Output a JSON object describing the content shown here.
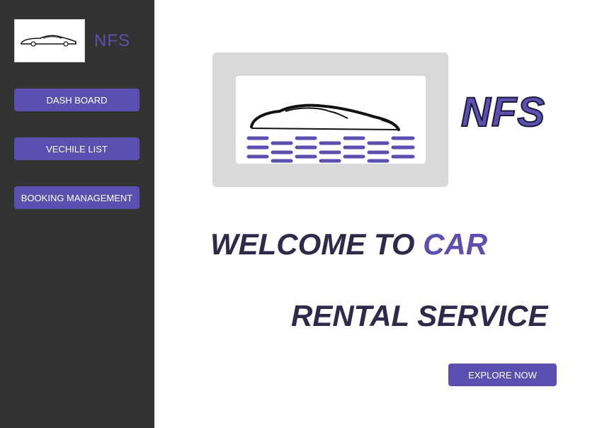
{
  "sidebar": {
    "brand": "NFS",
    "logo_icon": "car-silhouette-icon",
    "nav": [
      {
        "label": "DASH BOARD"
      },
      {
        "label": "VECHILE LIST"
      },
      {
        "label": "BOOKING MANAGEMENT"
      }
    ]
  },
  "hero": {
    "brand": "NFS",
    "image_icon": "car-logo-icon",
    "welcome_prefix": "WELCOME TO ",
    "welcome_accent": "CAR",
    "subtitle": "RENTAL SERVICE",
    "cta_label": "EXPLORE NOW"
  },
  "colors": {
    "accent": "#5b4fb0",
    "sidebar_bg": "#333333",
    "heading": "#2d2a4a"
  }
}
